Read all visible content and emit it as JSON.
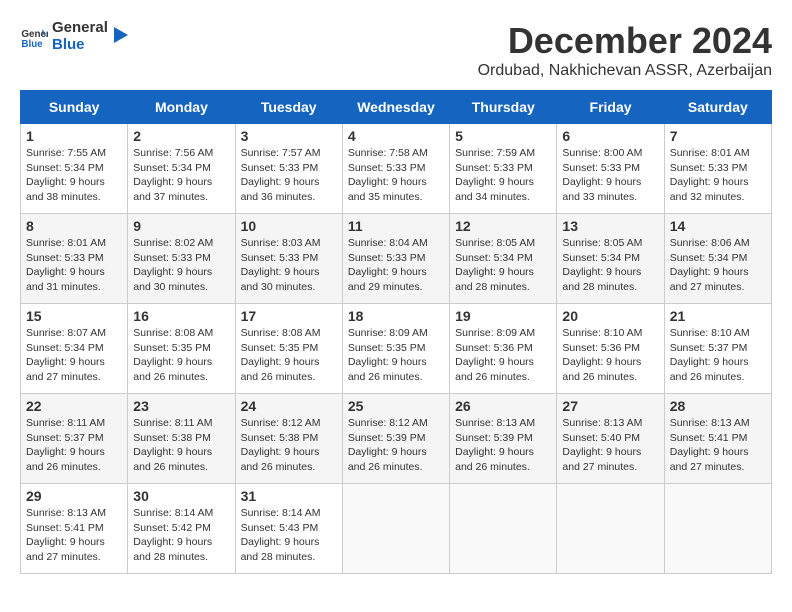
{
  "header": {
    "logo_general": "General",
    "logo_blue": "Blue",
    "month": "December 2024",
    "location": "Ordubad, Nakhichevan ASSR, Azerbaijan"
  },
  "weekdays": [
    "Sunday",
    "Monday",
    "Tuesday",
    "Wednesday",
    "Thursday",
    "Friday",
    "Saturday"
  ],
  "weeks": [
    [
      {
        "day": "1",
        "sunrise": "7:55 AM",
        "sunset": "5:34 PM",
        "daylight": "9 hours and 38 minutes."
      },
      {
        "day": "2",
        "sunrise": "7:56 AM",
        "sunset": "5:34 PM",
        "daylight": "9 hours and 37 minutes."
      },
      {
        "day": "3",
        "sunrise": "7:57 AM",
        "sunset": "5:33 PM",
        "daylight": "9 hours and 36 minutes."
      },
      {
        "day": "4",
        "sunrise": "7:58 AM",
        "sunset": "5:33 PM",
        "daylight": "9 hours and 35 minutes."
      },
      {
        "day": "5",
        "sunrise": "7:59 AM",
        "sunset": "5:33 PM",
        "daylight": "9 hours and 34 minutes."
      },
      {
        "day": "6",
        "sunrise": "8:00 AM",
        "sunset": "5:33 PM",
        "daylight": "9 hours and 33 minutes."
      },
      {
        "day": "7",
        "sunrise": "8:01 AM",
        "sunset": "5:33 PM",
        "daylight": "9 hours and 32 minutes."
      }
    ],
    [
      {
        "day": "8",
        "sunrise": "8:01 AM",
        "sunset": "5:33 PM",
        "daylight": "9 hours and 31 minutes."
      },
      {
        "day": "9",
        "sunrise": "8:02 AM",
        "sunset": "5:33 PM",
        "daylight": "9 hours and 30 minutes."
      },
      {
        "day": "10",
        "sunrise": "8:03 AM",
        "sunset": "5:33 PM",
        "daylight": "9 hours and 30 minutes."
      },
      {
        "day": "11",
        "sunrise": "8:04 AM",
        "sunset": "5:33 PM",
        "daylight": "9 hours and 29 minutes."
      },
      {
        "day": "12",
        "sunrise": "8:05 AM",
        "sunset": "5:34 PM",
        "daylight": "9 hours and 28 minutes."
      },
      {
        "day": "13",
        "sunrise": "8:05 AM",
        "sunset": "5:34 PM",
        "daylight": "9 hours and 28 minutes."
      },
      {
        "day": "14",
        "sunrise": "8:06 AM",
        "sunset": "5:34 PM",
        "daylight": "9 hours and 27 minutes."
      }
    ],
    [
      {
        "day": "15",
        "sunrise": "8:07 AM",
        "sunset": "5:34 PM",
        "daylight": "9 hours and 27 minutes."
      },
      {
        "day": "16",
        "sunrise": "8:08 AM",
        "sunset": "5:35 PM",
        "daylight": "9 hours and 26 minutes."
      },
      {
        "day": "17",
        "sunrise": "8:08 AM",
        "sunset": "5:35 PM",
        "daylight": "9 hours and 26 minutes."
      },
      {
        "day": "18",
        "sunrise": "8:09 AM",
        "sunset": "5:35 PM",
        "daylight": "9 hours and 26 minutes."
      },
      {
        "day": "19",
        "sunrise": "8:09 AM",
        "sunset": "5:36 PM",
        "daylight": "9 hours and 26 minutes."
      },
      {
        "day": "20",
        "sunrise": "8:10 AM",
        "sunset": "5:36 PM",
        "daylight": "9 hours and 26 minutes."
      },
      {
        "day": "21",
        "sunrise": "8:10 AM",
        "sunset": "5:37 PM",
        "daylight": "9 hours and 26 minutes."
      }
    ],
    [
      {
        "day": "22",
        "sunrise": "8:11 AM",
        "sunset": "5:37 PM",
        "daylight": "9 hours and 26 minutes."
      },
      {
        "day": "23",
        "sunrise": "8:11 AM",
        "sunset": "5:38 PM",
        "daylight": "9 hours and 26 minutes."
      },
      {
        "day": "24",
        "sunrise": "8:12 AM",
        "sunset": "5:38 PM",
        "daylight": "9 hours and 26 minutes."
      },
      {
        "day": "25",
        "sunrise": "8:12 AM",
        "sunset": "5:39 PM",
        "daylight": "9 hours and 26 minutes."
      },
      {
        "day": "26",
        "sunrise": "8:13 AM",
        "sunset": "5:39 PM",
        "daylight": "9 hours and 26 minutes."
      },
      {
        "day": "27",
        "sunrise": "8:13 AM",
        "sunset": "5:40 PM",
        "daylight": "9 hours and 27 minutes."
      },
      {
        "day": "28",
        "sunrise": "8:13 AM",
        "sunset": "5:41 PM",
        "daylight": "9 hours and 27 minutes."
      }
    ],
    [
      {
        "day": "29",
        "sunrise": "8:13 AM",
        "sunset": "5:41 PM",
        "daylight": "9 hours and 27 minutes."
      },
      {
        "day": "30",
        "sunrise": "8:14 AM",
        "sunset": "5:42 PM",
        "daylight": "9 hours and 28 minutes."
      },
      {
        "day": "31",
        "sunrise": "8:14 AM",
        "sunset": "5:43 PM",
        "daylight": "9 hours and 28 minutes."
      },
      null,
      null,
      null,
      null
    ]
  ]
}
